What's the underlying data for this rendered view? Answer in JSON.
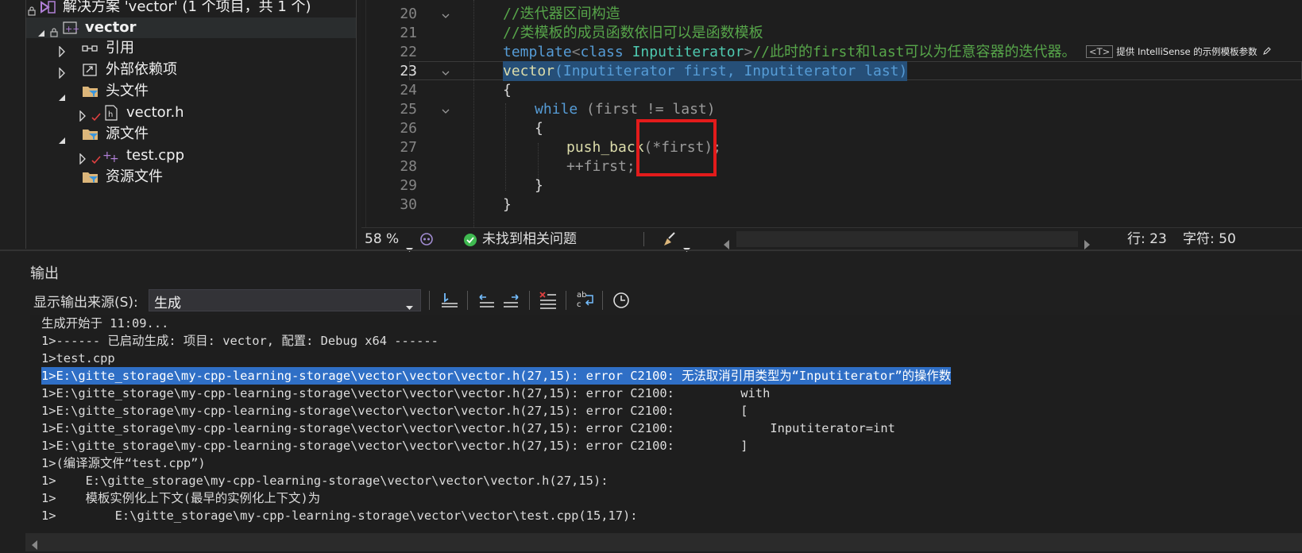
{
  "solution_explorer": {
    "solution_title": "解决方案 'vector' (1 个项目，共 1 个)",
    "project": "vector",
    "items": [
      {
        "label": "引用"
      },
      {
        "label": "外部依赖项"
      },
      {
        "label": "头文件"
      },
      {
        "label": "vector.h"
      },
      {
        "label": "源文件"
      },
      {
        "label": "test.cpp"
      },
      {
        "label": "资源文件"
      }
    ]
  },
  "editor": {
    "lines": [
      {
        "num": "20",
        "text": "//迭代器区间构造"
      },
      {
        "num": "21",
        "text": "//类模板的成员函数依旧可以是函数模板"
      },
      {
        "num": "22",
        "kw": "template",
        "lt": "<",
        "kw2": "class",
        "ty": "Inputiterator",
        "gt": ">",
        "cm": "//此时的first和last可以为任意容器的迭代器。"
      },
      {
        "num": "23",
        "fn": "vector",
        "rest": "(Inputiterator first, Inputiterator last)"
      },
      {
        "num": "24",
        "text": "{"
      },
      {
        "num": "25",
        "kw": "while",
        "rest": " (first != last)"
      },
      {
        "num": "26",
        "text": "{"
      },
      {
        "num": "27",
        "fn": "push_back",
        "rest": "(*first);"
      },
      {
        "num": "28",
        "text": "++first;"
      },
      {
        "num": "29",
        "text": "}"
      },
      {
        "num": "30",
        "text": "}"
      }
    ],
    "intellisense_hint": "提供 IntelliSense 的示例模板参数",
    "intellisense_tag": "<T>"
  },
  "editor_status": {
    "zoom": "58 %",
    "issues": "未找到相关问题",
    "line": "行: 23",
    "char": "字符: 50"
  },
  "output": {
    "title": "输出",
    "source_label": "显示输出来源(S):",
    "source_value": "生成",
    "lines": [
      "生成开始于 11:09...",
      "1>------ 已启动生成: 项目: vector, 配置: Debug x64 ------",
      "1>test.cpp",
      "1>E:\\gitte_storage\\my-cpp-learning-storage\\vector\\vector\\vector.h(27,15): error C2100: 无法取消引用类型为“Inputiterator”的操作数",
      "1>E:\\gitte_storage\\my-cpp-learning-storage\\vector\\vector\\vector.h(27,15): error C2100:         with",
      "1>E:\\gitte_storage\\my-cpp-learning-storage\\vector\\vector\\vector.h(27,15): error C2100:         [",
      "1>E:\\gitte_storage\\my-cpp-learning-storage\\vector\\vector\\vector.h(27,15): error C2100:             Inputiterator=int",
      "1>E:\\gitte_storage\\my-cpp-learning-storage\\vector\\vector\\vector.h(27,15): error C2100:         ]",
      "1>(编译源文件“test.cpp”)",
      "1>    E:\\gitte_storage\\my-cpp-learning-storage\\vector\\vector\\vector.h(27,15):",
      "1>    模板实例化上下文(最早的实例化上下文)为",
      "1>        E:\\gitte_storage\\my-cpp-learning-storage\\vector\\vector\\test.cpp(15,17):"
    ]
  },
  "colors": {
    "highlight_box": "#e31b1b",
    "selection": "#2f6fc6",
    "comment": "#57a64a",
    "keyword": "#569cd6"
  }
}
